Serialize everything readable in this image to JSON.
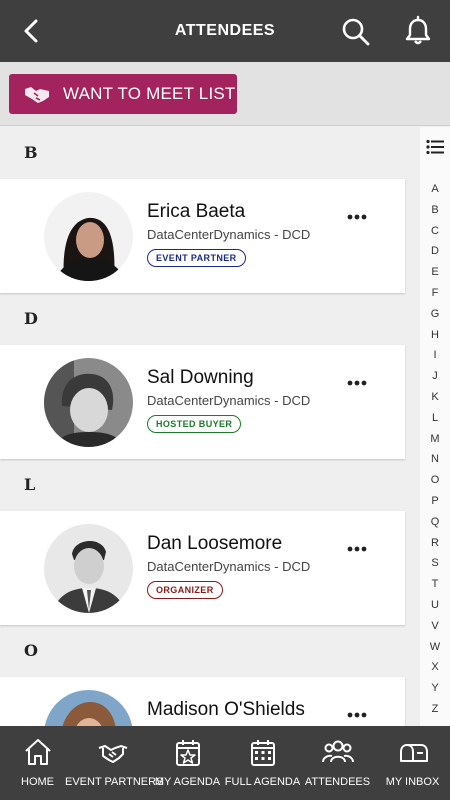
{
  "header": {
    "title": "ATTENDEES"
  },
  "meet_button": {
    "label": "WANT TO MEET LIST"
  },
  "sections": [
    {
      "letter": "B",
      "attendee": {
        "name": "Erica Baeta",
        "company": "DataCenterDynamics - DCD",
        "badge": "EVENT PARTNER",
        "badge_type": "partner"
      }
    },
    {
      "letter": "D",
      "attendee": {
        "name": "Sal Downing",
        "company": "DataCenterDynamics - DCD",
        "badge": "HOSTED BUYER",
        "badge_type": "buyer"
      }
    },
    {
      "letter": "L",
      "attendee": {
        "name": "Dan Loosemore",
        "company": "DataCenterDynamics - DCD",
        "badge": "ORGANIZER",
        "badge_type": "organizer"
      }
    },
    {
      "letter": "O",
      "attendee": {
        "name": "Madison O'Shields",
        "company": "",
        "badge": "",
        "badge_type": ""
      }
    }
  ],
  "index_letters": [
    "A",
    "B",
    "C",
    "D",
    "E",
    "F",
    "G",
    "H",
    "I",
    "J",
    "K",
    "L",
    "M",
    "N",
    "O",
    "P",
    "Q",
    "R",
    "S",
    "T",
    "U",
    "V",
    "W",
    "X",
    "Y",
    "Z"
  ],
  "bottom_nav": [
    {
      "label": "HOME",
      "icon": "home-icon"
    },
    {
      "label": "EVENT PARTNERS",
      "icon": "handshake-icon"
    },
    {
      "label": "MY AGENDA",
      "icon": "calendar-star-icon"
    },
    {
      "label": "FULL AGENDA",
      "icon": "calendar-grid-icon"
    },
    {
      "label": "ATTENDEES",
      "icon": "people-icon"
    },
    {
      "label": "MY INBOX",
      "icon": "mailbox-icon"
    }
  ],
  "colors": {
    "header": "#3f3f3f",
    "accent": "#a3235e",
    "partner": "#1a2a8a",
    "buyer": "#1e7a2c",
    "organizer": "#8a1a1a"
  }
}
